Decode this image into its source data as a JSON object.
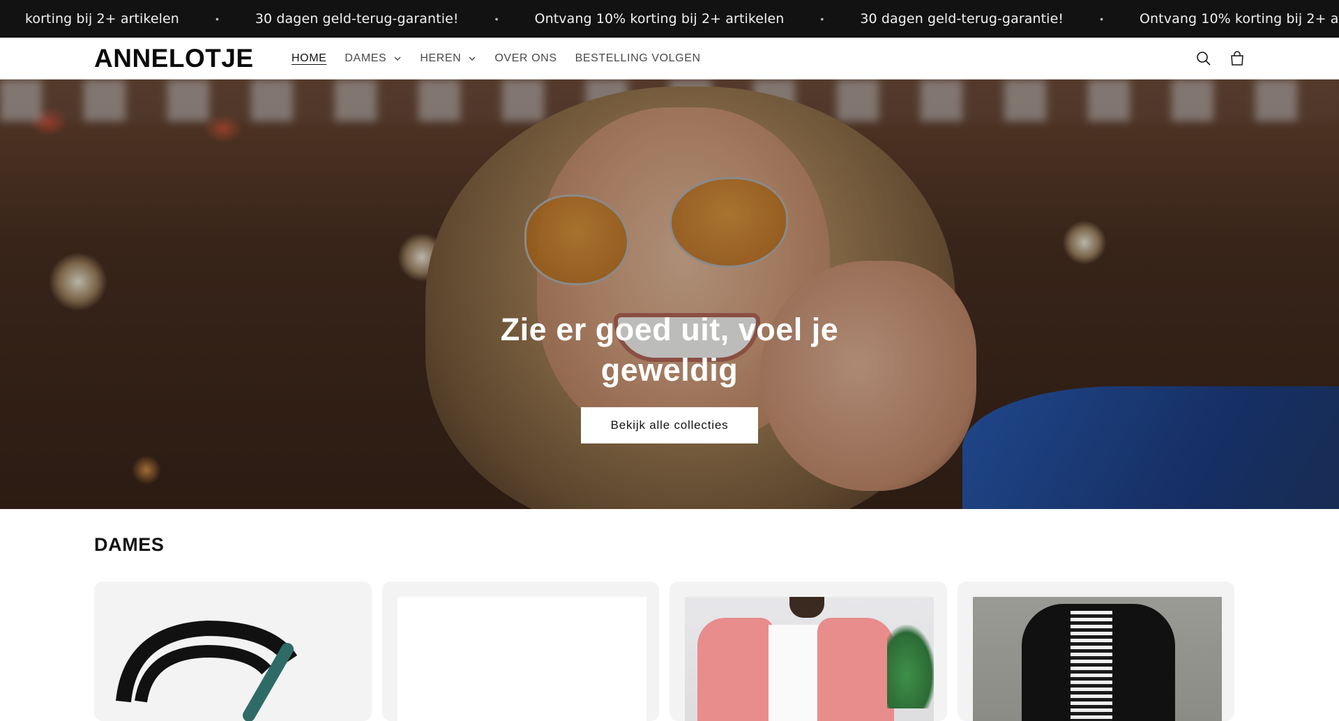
{
  "announcement": {
    "items": [
      "korting bij 2+ artikelen",
      "30 dagen geld-terug-garantie!",
      "Ontvang 10% korting bij 2+ artikelen",
      "30 dagen geld-terug-garantie!",
      "Ontvang 10% korting bij 2+ artikelen"
    ],
    "separator": "•"
  },
  "header": {
    "logo": "ANNELOTJE",
    "nav": [
      {
        "label": "HOME",
        "active": true,
        "dropdown": false
      },
      {
        "label": "DAMES",
        "active": false,
        "dropdown": true
      },
      {
        "label": "HEREN",
        "active": false,
        "dropdown": true
      },
      {
        "label": "OVER ONS",
        "active": false,
        "dropdown": false
      },
      {
        "label": "BESTELLING VOLGEN",
        "active": false,
        "dropdown": false
      }
    ],
    "icons": [
      "search-icon",
      "cart-icon"
    ]
  },
  "hero": {
    "title_line1": "Zie er goed uit, voel je",
    "title_line2": "geweldig",
    "button": "Bekijk alle collecties"
  },
  "collection": {
    "title": "DAMES",
    "cards": [
      {
        "image": "brand-logo-graphic"
      },
      {
        "image": "blank-white"
      },
      {
        "image": "pink-blazer-photo"
      },
      {
        "image": "black-blazer-photo"
      }
    ]
  },
  "colors": {
    "announcement_bg": "#121212",
    "text": "#121212",
    "card_bg": "#f3f3f3",
    "button_bg": "#ffffff"
  }
}
